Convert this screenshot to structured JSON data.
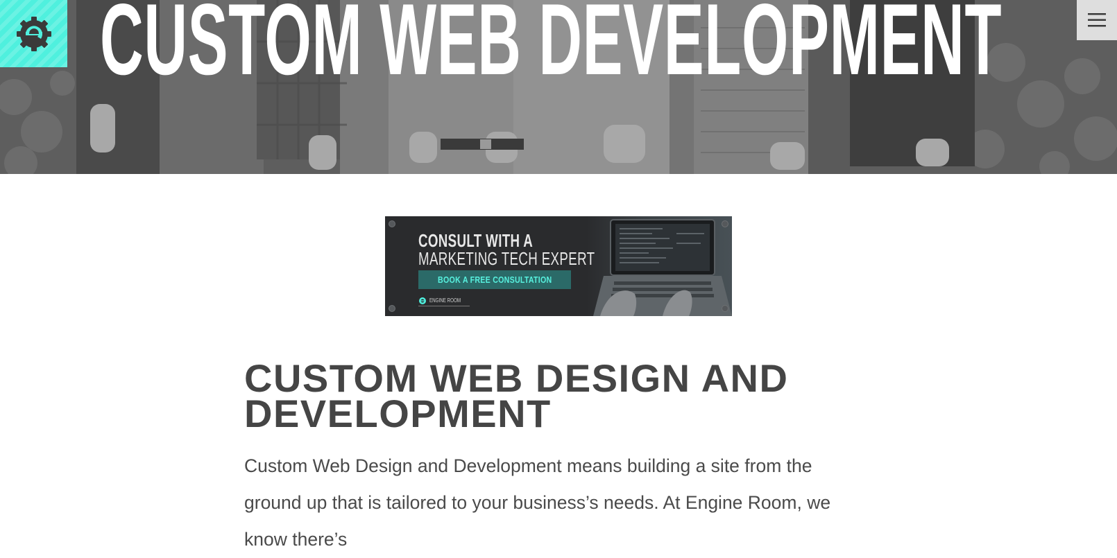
{
  "hero": {
    "title": "CUSTOM WEB DEVELOPMENT"
  },
  "header": {
    "logo_icon": "engine-room-gear-e-icon",
    "menu_icon": "hamburger-menu-icon",
    "accent_color": "#4ff0de"
  },
  "banner": {
    "heading_line1": "CONSULT WITH A",
    "heading_line2": "MARKETING TECH EXPERT",
    "cta_label": "BOOK A FREE CONSULTATION",
    "brand_label": "ENGINE ROOM",
    "cta_color": "#2b6a68",
    "cta_text_color": "#57f0de"
  },
  "content": {
    "title": "CUSTOM WEB DESIGN AND DEVELOPMENT",
    "body": "Custom Web Design and Development means building a site from the ground up that is tailored to your business’s needs. At Engine Room, we know there’s"
  }
}
